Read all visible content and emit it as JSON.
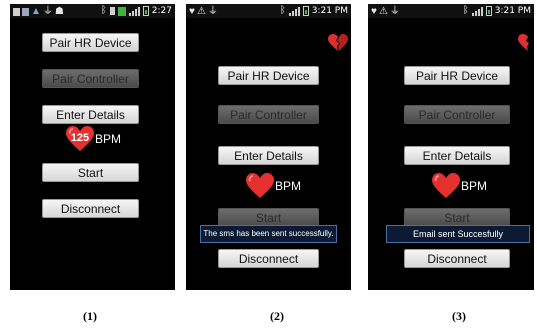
{
  "screens": [
    {
      "status_time": "2:27",
      "buttons": {
        "pair_hr": "Pair HR Device",
        "pair_controller": "Pair Controller",
        "enter_details": "Enter Details",
        "start": "Start",
        "disconnect": "Disconnect"
      },
      "heart_rate_value": "125",
      "heart_rate_unit": "BPM",
      "caption": "(1)"
    },
    {
      "status_time": "3:21 PM",
      "buttons": {
        "pair_hr": "Pair HR Device",
        "pair_controller": "Pair Controller",
        "enter_details": "Enter Details",
        "start": "Start",
        "disconnect": "Disconnect"
      },
      "heart_rate_unit": "BPM",
      "toast": "The sms has been sent successfully.",
      "caption": "(2)"
    },
    {
      "status_time": "3:21 PM",
      "buttons": {
        "pair_hr": "Pair HR Device",
        "pair_controller": "Pair Controller",
        "enter_details": "Enter Details",
        "start": "Start",
        "disconnect": "Disconnect"
      },
      "heart_rate_unit": "BPM",
      "toast": "Email sent Succesfully",
      "caption": "(3)"
    }
  ],
  "colors": {
    "heart_red": "#e53030",
    "toast_bg": "#0d1a33",
    "disabled_button": "#5a5a5a"
  },
  "icons": [
    "heart-icon",
    "broken-heart-icon",
    "bluetooth-icon",
    "signal-icon",
    "battery-icon",
    "warning-icon",
    "usb-icon"
  ]
}
